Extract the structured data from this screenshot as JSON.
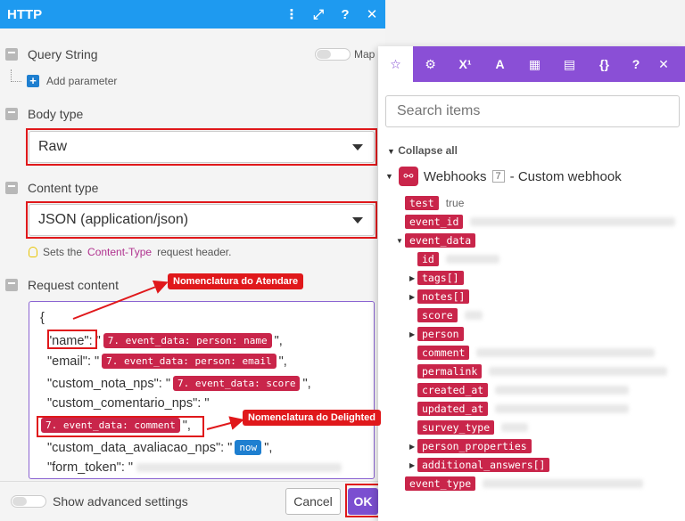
{
  "header": {
    "title": "HTTP",
    "icons": [
      "more-icon",
      "expand-icon",
      "help-icon",
      "close-icon"
    ]
  },
  "query_string": {
    "label": "Query String",
    "map_label": "Map",
    "add_parameter": "Add parameter"
  },
  "body_type": {
    "label": "Body type",
    "value": "Raw"
  },
  "content_type": {
    "label": "Content type",
    "value": "JSON (application/json)",
    "hint_prefix": "Sets the",
    "hint_code": "Content-Type",
    "hint_suffix": "request header."
  },
  "request_content": {
    "label": "Request content",
    "open_brace": "{",
    "lines": [
      {
        "key": "\"name\"",
        "sep": ":",
        "open_q": "\"",
        "pill": "7. event_data: person: name",
        "close": "\","
      },
      {
        "key": "\"email\"",
        "sep": ":",
        "open_q": "\"",
        "pill": "7. event_data: person: email",
        "close": "\","
      },
      {
        "key": "\"custom_nota_nps\"",
        "sep": ":",
        "open_q": "\"",
        "pill": "7. event_data: score",
        "close": "\","
      },
      {
        "key": "\"custom_comentario_nps\"",
        "sep": ":",
        "open_q": "\""
      },
      {
        "pill": "7. event_data: comment",
        "close": "\","
      },
      {
        "key": "\"custom_data_avaliacao_nps\"",
        "sep": ":",
        "open_q": "\"",
        "pill": "now",
        "close": "\","
      },
      {
        "key": "\"form_token\"",
        "sep": ":",
        "open_q": "\""
      }
    ]
  },
  "annotations": {
    "atendare": "Nomenclatura do Atendare",
    "delighted": "Nomenclatura do Delighted"
  },
  "footer": {
    "advanced": "Show advanced settings",
    "cancel": "Cancel",
    "ok": "OK"
  },
  "mapper": {
    "tabs": [
      "star-icon",
      "gear-icon",
      "superscript-icon",
      "text-icon",
      "calendar-icon",
      "table-icon",
      "braces-icon",
      "help-icon",
      "close-icon"
    ],
    "tab_glyphs": [
      "☆",
      "⚙",
      "X¹",
      "A",
      "▦",
      "▤",
      "{}",
      "?",
      "✕"
    ],
    "search_placeholder": "Search items",
    "collapse_all": "Collapse all",
    "module_name": "Webhooks",
    "module_num": "7",
    "module_suffix": "- Custom webhook",
    "items": [
      {
        "name": "test",
        "value": "true"
      },
      {
        "name": "event_id"
      },
      {
        "name": "event_data"
      },
      {
        "name": "id"
      },
      {
        "name": "tags[]"
      },
      {
        "name": "notes[]"
      },
      {
        "name": "score"
      },
      {
        "name": "person"
      },
      {
        "name": "comment"
      },
      {
        "name": "permalink"
      },
      {
        "name": "created_at"
      },
      {
        "name": "updated_at"
      },
      {
        "name": "survey_type"
      },
      {
        "name": "person_properties"
      },
      {
        "name": "additional_answers[]"
      },
      {
        "name": "event_type"
      }
    ]
  }
}
